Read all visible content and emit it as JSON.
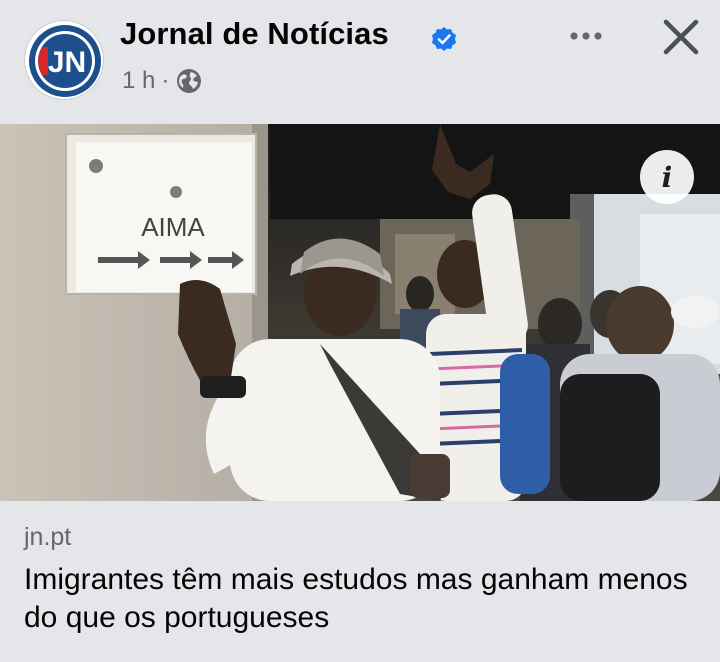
{
  "post": {
    "page_name": "Jornal de Notícias",
    "avatar_text": "JN",
    "time": "1 h",
    "separator": "·",
    "audience_icon": "globe-icon",
    "verified_icon": "verified-badge-icon",
    "more_icon": "more-options-icon",
    "close_icon": "close-icon"
  },
  "photo": {
    "sign_text": "AIMA",
    "info_label": "i"
  },
  "link": {
    "domain": "jn.pt",
    "title": "Imigrantes têm mais estudos mas ganham menos do que os portugueses"
  },
  "colors": {
    "background": "#e4e6ea",
    "verified_blue": "#1877f2",
    "logo_blue": "#1c4f8c",
    "logo_red": "#d62828",
    "secondary_text": "#65676b"
  }
}
